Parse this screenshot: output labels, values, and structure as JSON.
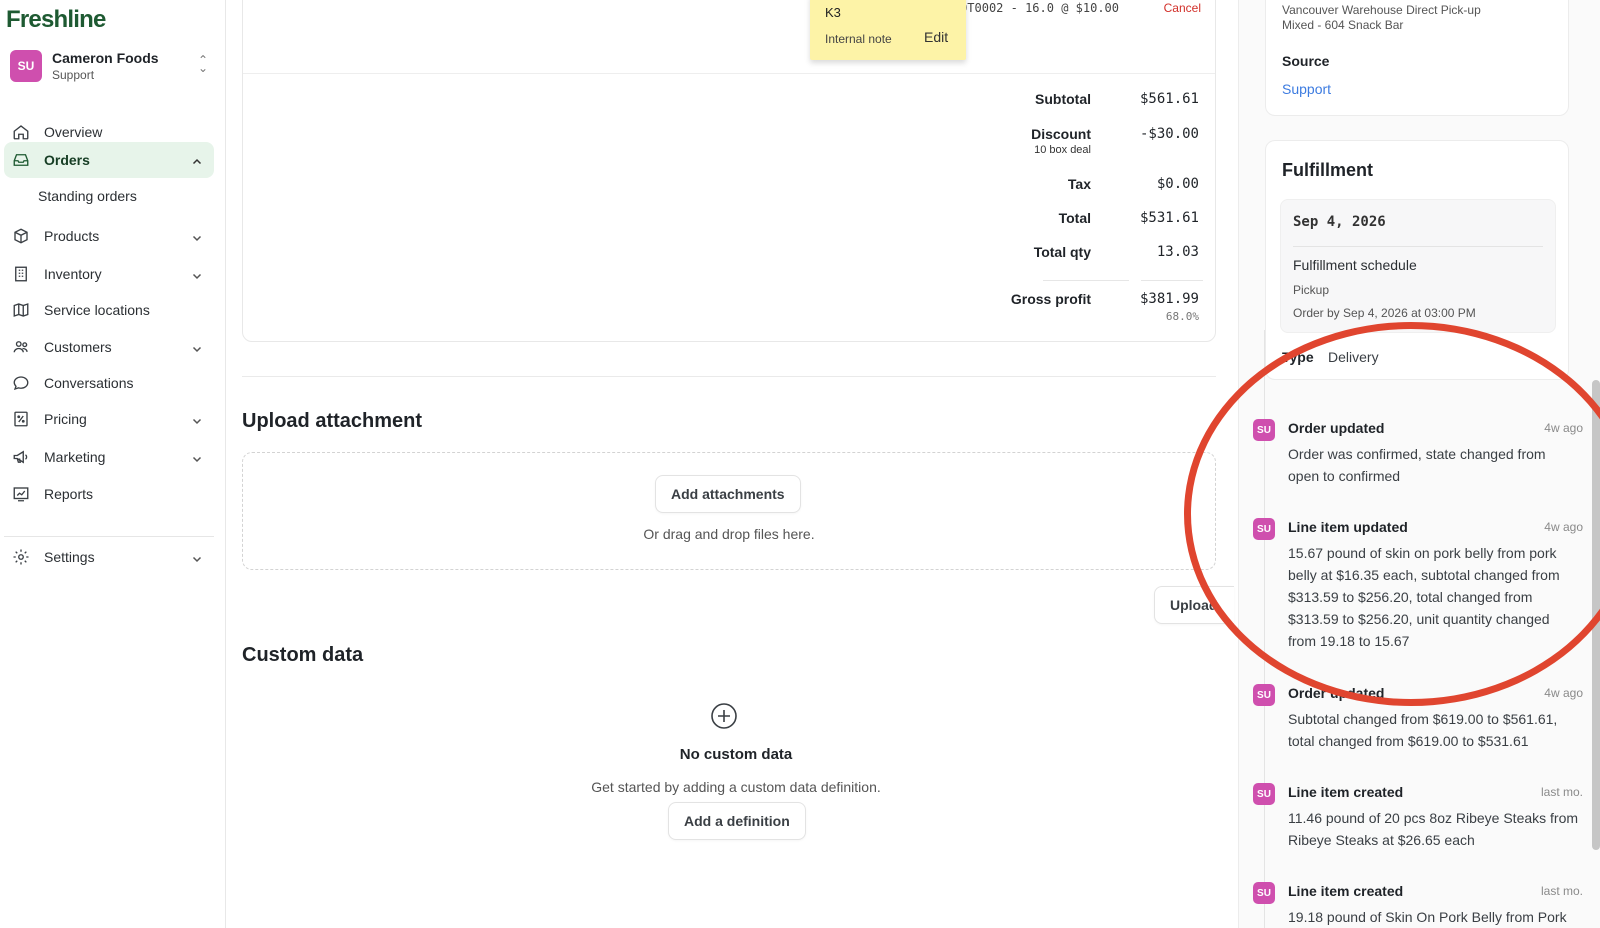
{
  "app": {
    "logo": "Freshline"
  },
  "account": {
    "initials": "SU",
    "name": "Cameron Foods",
    "role": "Support"
  },
  "nav": {
    "items": [
      {
        "label": "Overview",
        "icon": "home-icon"
      },
      {
        "label": "Orders",
        "icon": "inbox-icon",
        "active": true
      },
      {
        "label": "Products",
        "icon": "box-icon"
      },
      {
        "label": "Inventory",
        "icon": "building-icon"
      },
      {
        "label": "Service locations",
        "icon": "map-icon"
      },
      {
        "label": "Customers",
        "icon": "users-icon"
      },
      {
        "label": "Conversations",
        "icon": "chat-icon"
      },
      {
        "label": "Pricing",
        "icon": "percent-icon"
      },
      {
        "label": "Marketing",
        "icon": "megaphone-icon"
      },
      {
        "label": "Reports",
        "icon": "chart-icon"
      },
      {
        "label": "Settings",
        "icon": "gear-icon"
      }
    ],
    "sub_items": [
      "Standing orders"
    ]
  },
  "line_item": {
    "text": "Pork Belly - Lot LOT0002 - 16.0 @ $10.00",
    "cancel": "Cancel"
  },
  "sticky_note": {
    "code": "K3",
    "label": "Internal note",
    "edit": "Edit"
  },
  "totals": {
    "subtotal_label": "Subtotal",
    "subtotal": "$561.61",
    "discount_label": "Discount",
    "discount_note": "10 box deal",
    "discount": "-$30.00",
    "tax_label": "Tax",
    "tax": "$0.00",
    "total_label": "Total",
    "total": "$531.61",
    "qty_label": "Total qty",
    "qty": "13.03",
    "profit_label": "Gross profit",
    "profit": "$381.99",
    "profit_pct": "68.0%"
  },
  "upload": {
    "title": "Upload attachment",
    "add_button": "Add attachments",
    "hint": "Or drag and drop files here.",
    "upload_button": "Upload"
  },
  "custom_data": {
    "title": "Custom data",
    "empty_title": "No custom data",
    "empty_sub": "Get started by adding a custom data definition.",
    "add_button": "Add a definition"
  },
  "location_card": {
    "line1": "Vancouver Warehouse Direct Pick-up",
    "line2": "Mixed - 604 Snack Bar",
    "source_label": "Source",
    "source_value": "Support"
  },
  "fulfillment": {
    "title": "Fulfillment",
    "date": "Sep 4, 2026",
    "schedule_label": "Fulfillment schedule",
    "method": "Pickup",
    "order_by": "Order by Sep 4, 2026 at 03:00 PM",
    "type_label": "Type",
    "type_value": "Delivery"
  },
  "activity": [
    {
      "initials": "SU",
      "title": "Order updated",
      "time": "4w ago",
      "body": "Order was confirmed, state changed from open to confirmed"
    },
    {
      "initials": "SU",
      "title": "Line item updated",
      "time": "4w ago",
      "body": "15.67 pound of skin on pork belly from pork belly at $16.35 each, subtotal changed from $313.59 to $256.20, total changed from $313.59 to $256.20, unit quantity changed from 19.18 to 15.67"
    },
    {
      "initials": "SU",
      "title": "Order updated",
      "time": "4w ago",
      "body": "Subtotal changed from $619.00 to $561.61, total changed from $619.00 to $531.61"
    },
    {
      "initials": "SU",
      "title": "Line item created",
      "time": "last mo.",
      "body": "11.46 pound of 20 pcs 8oz Ribeye Steaks from Ribeye Steaks at $26.65 each"
    },
    {
      "initials": "SU",
      "title": "Line item created",
      "time": "last mo.",
      "body": "19.18 pound of Skin On Pork Belly from Pork"
    }
  ],
  "colors": {
    "accent_green": "#1e5a32",
    "active_bg": "#e7f4ea",
    "avatar": "#cf4fae",
    "link": "#3c7be0",
    "danger": "#d2302a",
    "annotation": "#e0452f"
  }
}
